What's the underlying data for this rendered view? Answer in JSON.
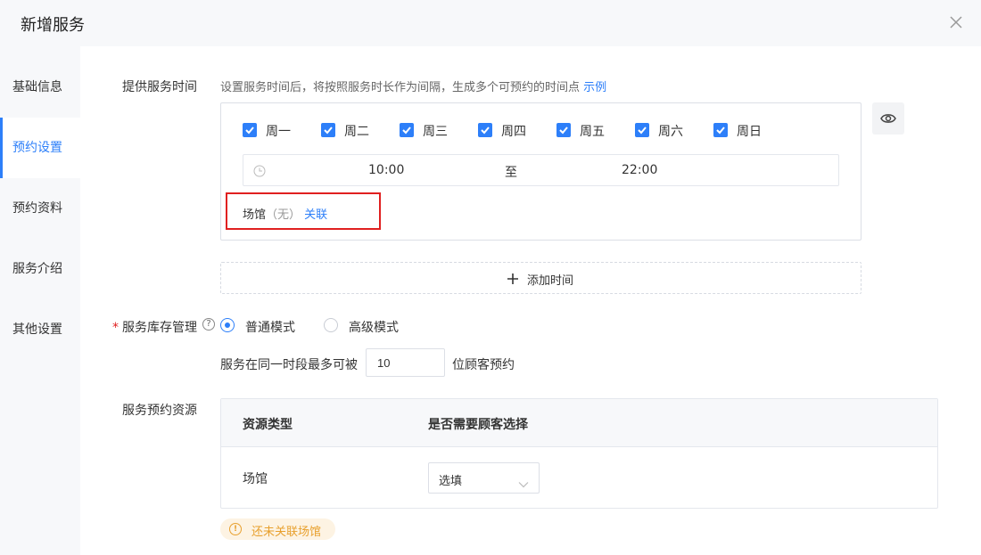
{
  "dialog": {
    "title": "新增服务"
  },
  "sidebar": {
    "items": [
      {
        "label": "基础信息",
        "active": false
      },
      {
        "label": "预约设置",
        "active": true
      },
      {
        "label": "预约资料",
        "active": false
      },
      {
        "label": "服务介绍",
        "active": false
      },
      {
        "label": "其他设置",
        "active": false
      }
    ]
  },
  "service_time": {
    "label": "提供服务时间",
    "hint": "设置服务时间后，将按照服务时长作为间隔，生成多个可预约的时间点",
    "example_link": "示例",
    "days": [
      {
        "label": "周一",
        "checked": true
      },
      {
        "label": "周二",
        "checked": true
      },
      {
        "label": "周三",
        "checked": true
      },
      {
        "label": "周四",
        "checked": true
      },
      {
        "label": "周五",
        "checked": true
      },
      {
        "label": "周六",
        "checked": true
      },
      {
        "label": "周日",
        "checked": true
      }
    ],
    "start_time": "10:00",
    "separator": "至",
    "end_time": "22:00",
    "venue_label": "场馆",
    "venue_value": "（无）",
    "venue_link": "关联",
    "add_time": "添加时间"
  },
  "inventory": {
    "required_mark": "*",
    "label": "服务库存管理",
    "help_icon": "question-icon",
    "modes": [
      {
        "label": "普通模式",
        "selected": true
      },
      {
        "label": "高级模式",
        "selected": false
      }
    ],
    "prefix": "服务在同一时段最多可被",
    "max_value": "10",
    "suffix": "位顾客预约"
  },
  "resources": {
    "label": "服务预约资源",
    "headers": [
      "资源类型",
      "是否需要顾客选择"
    ],
    "rows": [
      {
        "type": "场馆",
        "select_value": "选填"
      }
    ],
    "warning": "还未关联场馆"
  },
  "colors": {
    "primary": "#2d7ff9",
    "warning": "#e8a02e",
    "highlight_border": "#e02020"
  }
}
